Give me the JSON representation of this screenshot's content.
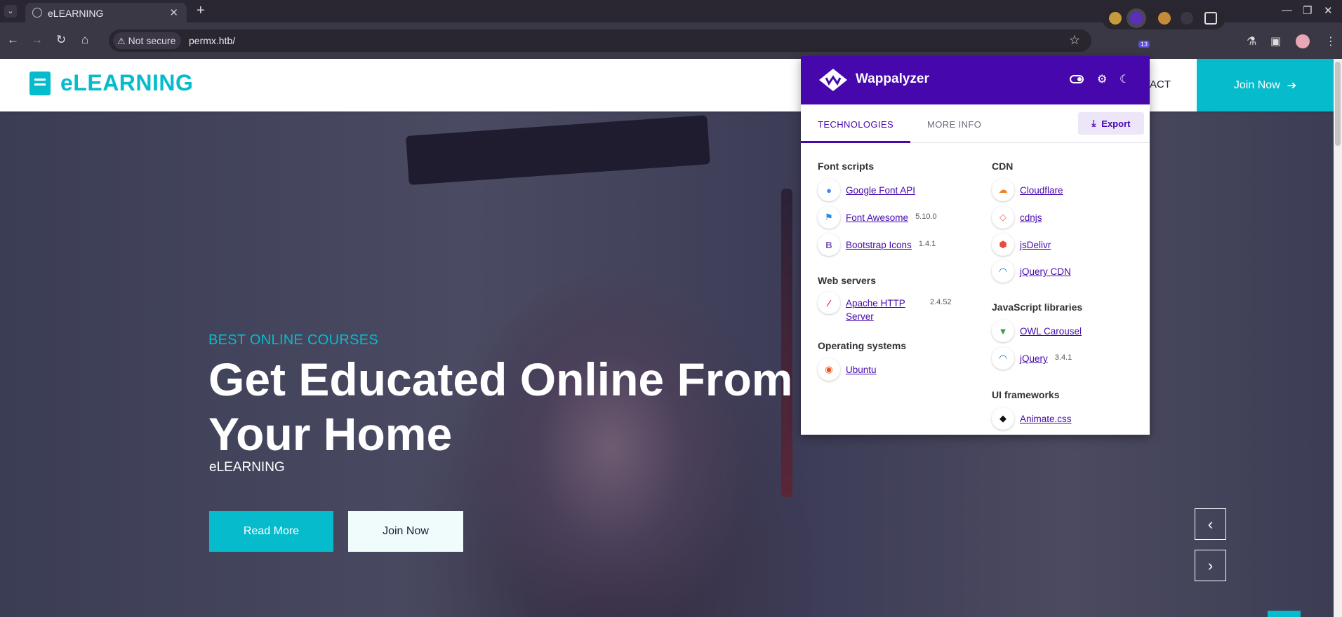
{
  "browser": {
    "tab_title": "eLEARNING",
    "security_label": "Not secure",
    "url": "permx.htb/",
    "extension_badge": "13"
  },
  "site": {
    "brand": "eLEARNING",
    "nav_partial_item": "TACT",
    "join_top": "Join Now",
    "hero": {
      "subtitle": "BEST ONLINE COURSES",
      "title": "Get Educated Online From Your Home",
      "text": "eLEARNING",
      "read_more": "Read More",
      "join_now": "Join Now"
    },
    "colors": {
      "accent": "#06bbcc",
      "dark": "#181d38"
    }
  },
  "wappalyzer": {
    "title": "Wappalyzer",
    "tabs": {
      "technologies": "TECHNOLOGIES",
      "more_info": "MORE INFO"
    },
    "export_label": "Export",
    "header_color": "#4608ad",
    "left_column": [
      {
        "category": "Font scripts",
        "items": [
          {
            "name": "Google Font API",
            "version": "",
            "icon": "google-fonts-icon"
          },
          {
            "name": "Font Awesome",
            "version": "5.10.0",
            "icon": "font-awesome-flag-icon"
          },
          {
            "name": "Bootstrap Icons",
            "version": "1.4.1",
            "icon": "bootstrap-icon"
          }
        ]
      },
      {
        "category": "Web servers",
        "items": [
          {
            "name": "Apache HTTP Server",
            "version": "2.4.52",
            "icon": "apache-feather-icon"
          }
        ]
      },
      {
        "category": "Operating systems",
        "items": [
          {
            "name": "Ubuntu",
            "version": "",
            "icon": "ubuntu-icon"
          }
        ]
      }
    ],
    "right_column": [
      {
        "category": "CDN",
        "items": [
          {
            "name": "Cloudflare",
            "version": "",
            "icon": "cloudflare-icon"
          },
          {
            "name": "cdnjs",
            "version": "",
            "icon": "cdnjs-icon"
          },
          {
            "name": "jsDelivr",
            "version": "",
            "icon": "jsdelivr-icon"
          },
          {
            "name": "jQuery CDN",
            "version": "",
            "icon": "jquery-icon"
          }
        ]
      },
      {
        "category": "JavaScript libraries",
        "items": [
          {
            "name": "OWL Carousel",
            "version": "",
            "icon": "owl-icon"
          },
          {
            "name": "jQuery",
            "version": "3.4.1",
            "icon": "jquery-icon"
          }
        ]
      },
      {
        "category": "UI frameworks",
        "items": [
          {
            "name": "Animate.css",
            "version": "",
            "icon": "animate-css-icon"
          }
        ]
      }
    ]
  }
}
